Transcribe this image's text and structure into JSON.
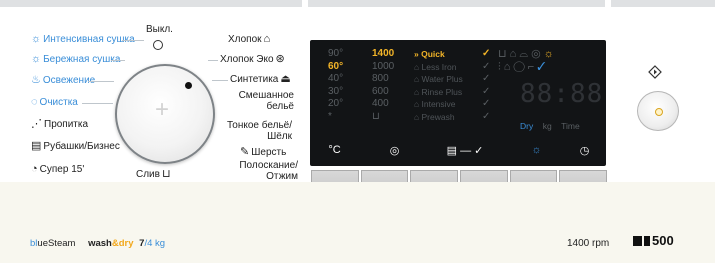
{
  "programs_left": [
    {
      "label": "Интенсивная сушка",
      "icon": "sun-icon",
      "color": "#3a8ed8"
    },
    {
      "label": "Бережная сушка",
      "icon": "sun-icon",
      "color": "#3a8ed8"
    },
    {
      "label": "Освежение",
      "icon": "steam-icon",
      "color": "#3a8ed8"
    },
    {
      "label": "Очистка",
      "icon": "clean-icon",
      "color": "#3a8ed8"
    },
    {
      "label": "Пропитка",
      "icon": "impregnation-icon",
      "color": "#222222"
    },
    {
      "label": "Рубашки/Бизнес",
      "icon": "shirt-icon",
      "color": "#222222"
    },
    {
      "label": "Супер 15'",
      "icon": "timer-icon",
      "color": "#222222"
    }
  ],
  "programs_right": [
    {
      "label": "Хлопок",
      "icon": "cotton-icon"
    },
    {
      "label": "Хлопок Эко",
      "icon": "eco-icon"
    },
    {
      "label": "Синтетика",
      "icon": "synthetic-icon"
    },
    {
      "label": "Смешанное бельё",
      "icon": "mixed-icon"
    },
    {
      "label": "Тонкое бельё/Шёлк",
      "icon": "delicate-icon"
    },
    {
      "label": "Шерсть",
      "icon": "wool-icon"
    },
    {
      "label": "Полоскание/ Отжим",
      "icon": "rinse-spin-icon"
    }
  ],
  "knob": {
    "off_label": "Выкл.",
    "drain_label": "Слив"
  },
  "display": {
    "temperatures": [
      "90°",
      "60°",
      "40°",
      "30°",
      "20°",
      "*"
    ],
    "temperature_selected": "60°",
    "spin_speeds": [
      "1400",
      "1000",
      "800",
      "600",
      "400",
      "⊔"
    ],
    "spin_selected": "1400",
    "options": [
      "Quick",
      "Less Iron",
      "Water Plus",
      "Rinse Plus",
      "Intensive",
      "Prewash"
    ],
    "option_selected": "Quick",
    "time_digits": "88:88",
    "time_lit": ":",
    "dry_label": "Dry",
    "kg_label": "kg",
    "time_label": "Time"
  },
  "buttons": [
    {
      "label": "°C"
    },
    {
      "label": "◎"
    },
    {
      "label": "▤ — ✓"
    },
    {
      "label": "☼"
    },
    {
      "label": "◷"
    }
  ],
  "brand": {
    "b1": "bl",
    "b2": "ueSteam",
    "wash": "wash",
    "amp": "&dry",
    "load": "7",
    "load_suffix": "/4 kg"
  },
  "rpm": "1400 rpm",
  "model": "500"
}
